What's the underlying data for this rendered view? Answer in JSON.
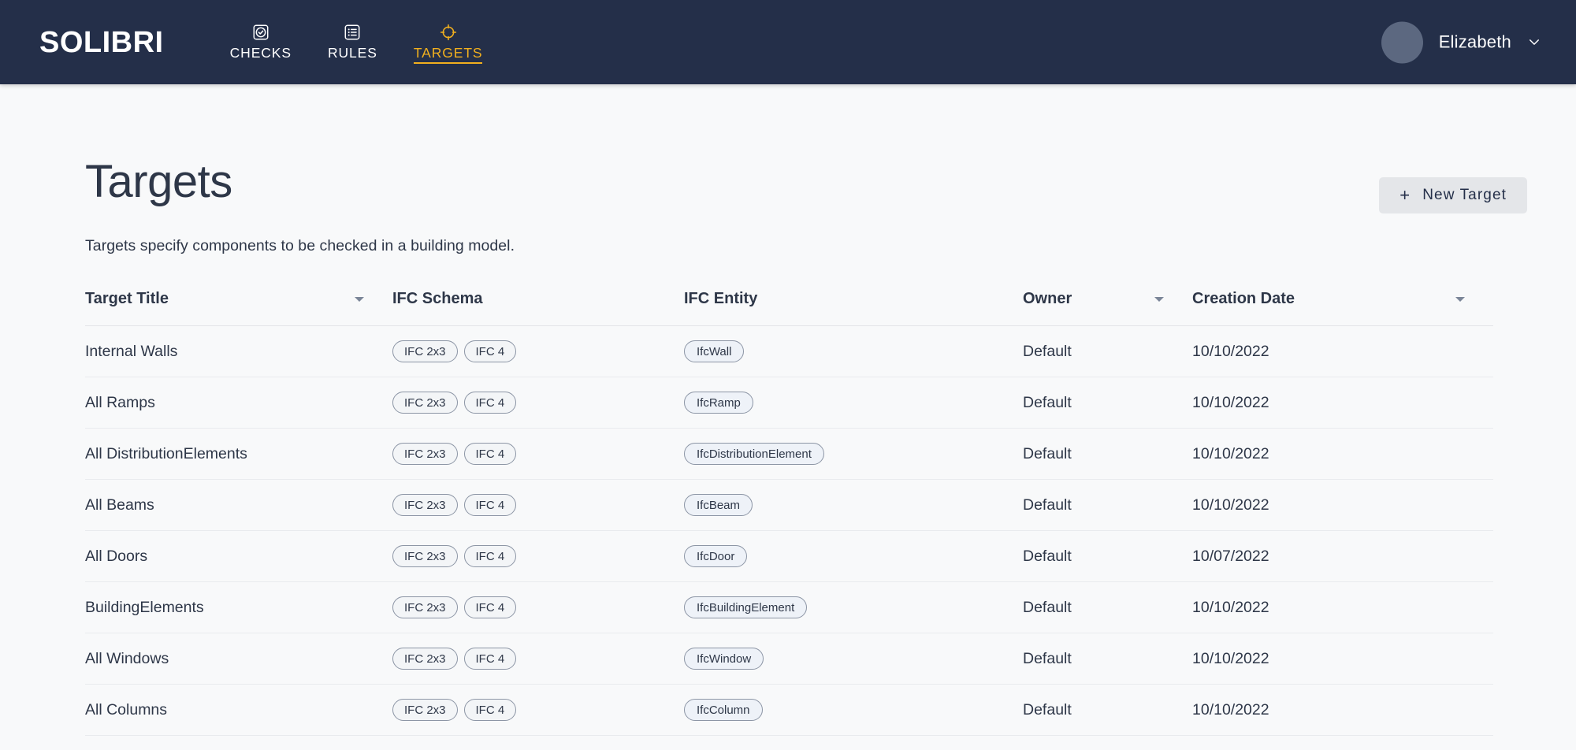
{
  "header": {
    "brand": "SOLIBRI",
    "nav": [
      {
        "label": "CHECKS",
        "icon": "checkbox-icon",
        "active": false
      },
      {
        "label": "RULES",
        "icon": "list-icon",
        "active": false
      },
      {
        "label": "TARGETS",
        "icon": "target-icon",
        "active": true
      }
    ],
    "user": {
      "name": "Elizabeth",
      "chevron": "chevron-down-icon"
    },
    "colors": {
      "background": "#242f49",
      "accent": "#f2b01e",
      "avatar": "#5c6880"
    }
  },
  "page": {
    "title": "Targets",
    "subtitle": "Targets specify components to be checked in a building model.",
    "new_target_button": {
      "label": "New Target",
      "plus": "+"
    }
  },
  "table": {
    "columns": [
      {
        "key": "title",
        "label": "Target Title",
        "sortable": true
      },
      {
        "key": "schema",
        "label": "IFC Schema",
        "sortable": false
      },
      {
        "key": "entity",
        "label": "IFC Entity",
        "sortable": false
      },
      {
        "key": "owner",
        "label": "Owner",
        "sortable": true
      },
      {
        "key": "date",
        "label": "Creation Date",
        "sortable": true
      }
    ],
    "rows": [
      {
        "title": "Internal Walls",
        "schemas": [
          "IFC 2x3",
          "IFC 4"
        ],
        "entity": "IfcWall",
        "owner": "Default",
        "date": "10/10/2022"
      },
      {
        "title": "All Ramps",
        "schemas": [
          "IFC 2x3",
          "IFC 4"
        ],
        "entity": "IfcRamp",
        "owner": "Default",
        "date": "10/10/2022"
      },
      {
        "title": "All DistributionElements",
        "schemas": [
          "IFC 2x3",
          "IFC 4"
        ],
        "entity": "IfcDistributionElement",
        "owner": "Default",
        "date": "10/10/2022"
      },
      {
        "title": "All Beams",
        "schemas": [
          "IFC 2x3",
          "IFC 4"
        ],
        "entity": "IfcBeam",
        "owner": "Default",
        "date": "10/10/2022"
      },
      {
        "title": "All Doors",
        "schemas": [
          "IFC 2x3",
          "IFC 4"
        ],
        "entity": "IfcDoor",
        "owner": "Default",
        "date": "10/07/2022"
      },
      {
        "title": "BuildingElements",
        "schemas": [
          "IFC 2x3",
          "IFC 4"
        ],
        "entity": "IfcBuildingElement",
        "owner": "Default",
        "date": "10/10/2022"
      },
      {
        "title": "All Windows",
        "schemas": [
          "IFC 2x3",
          "IFC 4"
        ],
        "entity": "IfcWindow",
        "owner": "Default",
        "date": "10/10/2022"
      },
      {
        "title": "All Columns",
        "schemas": [
          "IFC 2x3",
          "IFC 4"
        ],
        "entity": "IfcColumn",
        "owner": "Default",
        "date": "10/10/2022"
      }
    ]
  }
}
